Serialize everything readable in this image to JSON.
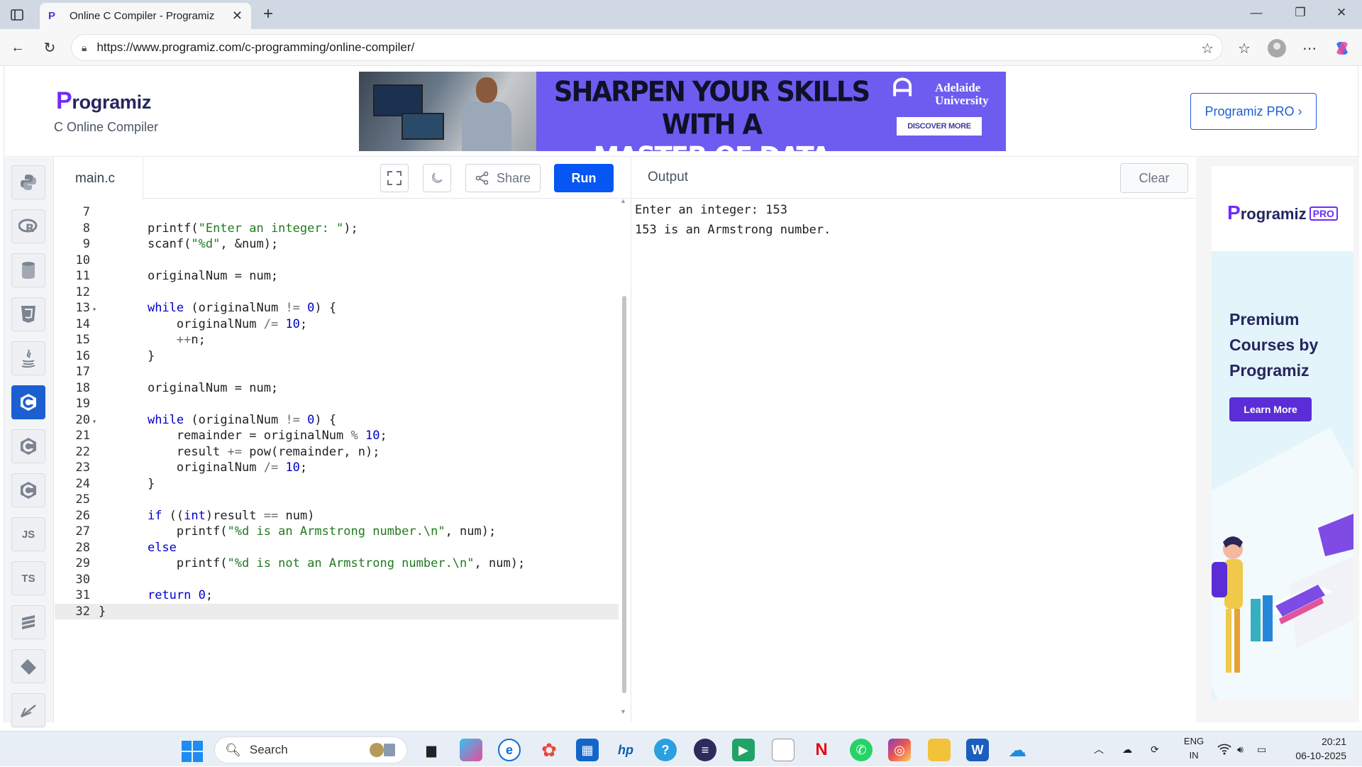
{
  "browser": {
    "tab_title": "Online C Compiler - Programiz",
    "url": "https://www.programiz.com/c-programming/online-compiler/"
  },
  "site": {
    "logo": "rogramiz",
    "logo_initial": "P",
    "subtitle": "C Online Compiler",
    "pro_button": "Programiz PRO ›",
    "banner": {
      "headline_line1": "SHARPEN YOUR SKILLS WITH A",
      "headline_line2": "MASTER OF DATA SCIENCE",
      "university_line1": "Adelaide",
      "university_line2": "University",
      "cta": "DISCOVER MORE"
    }
  },
  "rail": {
    "js_label": "JS",
    "ts_label": "TS"
  },
  "editor": {
    "file_name": "main.c",
    "share_label": "Share",
    "run_label": "Run",
    "lines": [
      {
        "n": "7",
        "fold": "",
        "code": ""
      },
      {
        "n": "8",
        "fold": "",
        "code": "    printf(\"Enter an integer: \");"
      },
      {
        "n": "9",
        "fold": "",
        "code": "    scanf(\"%d\", &num);"
      },
      {
        "n": "10",
        "fold": "",
        "code": ""
      },
      {
        "n": "11",
        "fold": "",
        "code": "    originalNum = num;"
      },
      {
        "n": "12",
        "fold": "",
        "code": ""
      },
      {
        "n": "13",
        "fold": "▾",
        "code": "    while (originalNum != 0) {"
      },
      {
        "n": "14",
        "fold": "",
        "code": "        originalNum /= 10;"
      },
      {
        "n": "15",
        "fold": "",
        "code": "        ++n;"
      },
      {
        "n": "16",
        "fold": "",
        "code": "    }"
      },
      {
        "n": "17",
        "fold": "",
        "code": ""
      },
      {
        "n": "18",
        "fold": "",
        "code": "    originalNum = num;"
      },
      {
        "n": "19",
        "fold": "",
        "code": ""
      },
      {
        "n": "20",
        "fold": "▾",
        "code": "    while (originalNum != 0) {"
      },
      {
        "n": "21",
        "fold": "",
        "code": "        remainder = originalNum % 10;"
      },
      {
        "n": "22",
        "fold": "",
        "code": "        result += pow(remainder, n);"
      },
      {
        "n": "23",
        "fold": "",
        "code": "        originalNum /= 10;"
      },
      {
        "n": "24",
        "fold": "",
        "code": "    }"
      },
      {
        "n": "25",
        "fold": "",
        "code": ""
      },
      {
        "n": "26",
        "fold": "",
        "code": "    if ((int)result == num)"
      },
      {
        "n": "27",
        "fold": "",
        "code": "        printf(\"%d is an Armstrong number.\\n\", num);"
      },
      {
        "n": "28",
        "fold": "",
        "code": "    else"
      },
      {
        "n": "29",
        "fold": "",
        "code": "        printf(\"%d is not an Armstrong number.\\n\", num);"
      },
      {
        "n": "30",
        "fold": "",
        "code": ""
      },
      {
        "n": "31",
        "fold": "",
        "code": "    return 0;"
      },
      {
        "n": "32",
        "fold": "",
        "code": "}"
      }
    ]
  },
  "output": {
    "title": "Output",
    "clear_label": "Clear",
    "text": "Enter an integer: 153\n153 is an Armstrong number."
  },
  "ad": {
    "logo_initial": "P",
    "logo": "rogramiz",
    "pro_tag": "PRO",
    "text_line1": "Premium",
    "text_line2": "Courses by",
    "text_line3": "Programiz",
    "cta": "Learn More"
  },
  "taskbar": {
    "search_placeholder": "Search",
    "lang_line1": "ENG",
    "lang_line2": "IN",
    "time": "20:21",
    "date": "06-10-2025"
  },
  "colors": {
    "accent": "#0556f3",
    "brand_purple": "#6f2bff",
    "keyword": "#0000cc",
    "string": "#217a1e"
  }
}
